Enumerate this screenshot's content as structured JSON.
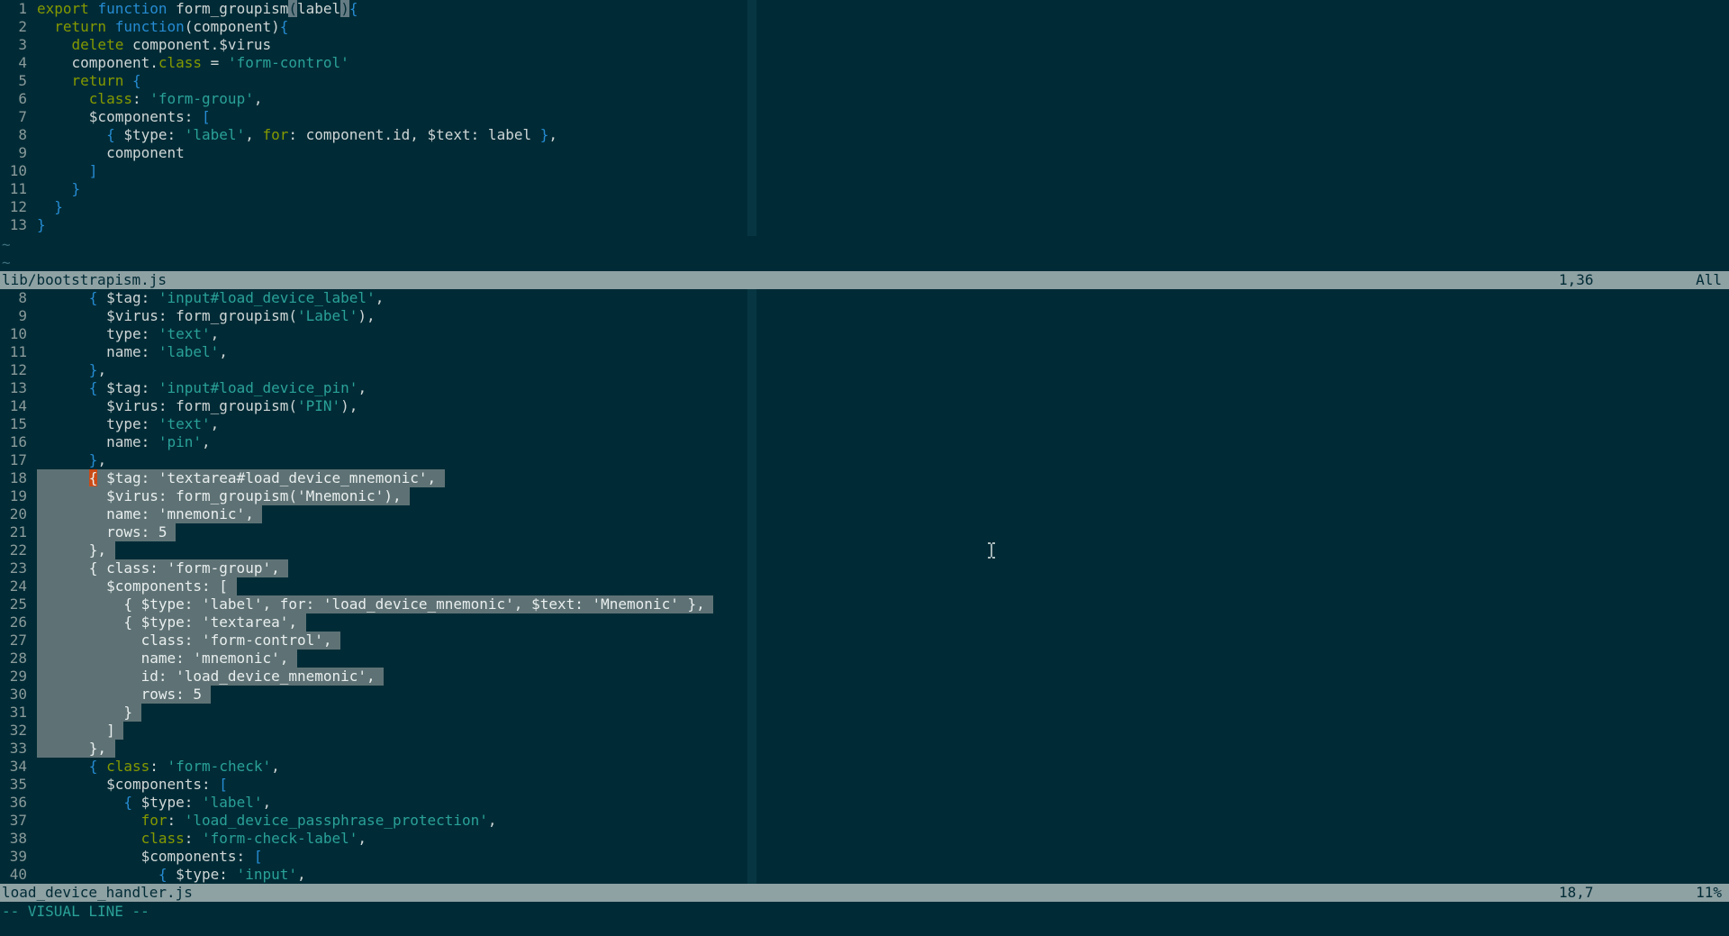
{
  "top_pane": {
    "lines": [
      {
        "n": "1",
        "tokens": [
          {
            "t": "export ",
            "c": "k"
          },
          {
            "t": "function ",
            "c": "f"
          },
          {
            "t": "form_groupism"
          },
          {
            "t": "(",
            "c": "cur"
          },
          {
            "t": "label"
          },
          {
            "t": ")",
            "c": "cur"
          },
          {
            "t": "{",
            "c": "p"
          }
        ]
      },
      {
        "n": "2",
        "tokens": [
          {
            "t": "  "
          },
          {
            "t": "return ",
            "c": "k"
          },
          {
            "t": "function",
            "c": "f"
          },
          {
            "t": "(component)"
          },
          {
            "t": "{",
            "c": "p"
          }
        ]
      },
      {
        "n": "3",
        "tokens": [
          {
            "t": "    "
          },
          {
            "t": "delete ",
            "c": "k"
          },
          {
            "t": "component.$virus"
          }
        ]
      },
      {
        "n": "4",
        "tokens": [
          {
            "t": "    component."
          },
          {
            "t": "class",
            "c": "k"
          },
          {
            "t": " = "
          },
          {
            "t": "'form-control'",
            "c": "s"
          }
        ]
      },
      {
        "n": "5",
        "tokens": [
          {
            "t": "    "
          },
          {
            "t": "return ",
            "c": "k"
          },
          {
            "t": "{",
            "c": "p"
          }
        ]
      },
      {
        "n": "6",
        "tokens": [
          {
            "t": "      "
          },
          {
            "t": "class",
            "c": "k"
          },
          {
            "t": ": "
          },
          {
            "t": "'form-group'",
            "c": "s"
          },
          {
            "t": ","
          }
        ]
      },
      {
        "n": "7",
        "tokens": [
          {
            "t": "      $components: "
          },
          {
            "t": "[",
            "c": "p"
          }
        ]
      },
      {
        "n": "8",
        "tokens": [
          {
            "t": "        "
          },
          {
            "t": "{",
            "c": "p"
          },
          {
            "t": " $type: "
          },
          {
            "t": "'label'",
            "c": "s"
          },
          {
            "t": ", "
          },
          {
            "t": "for",
            "c": "k"
          },
          {
            "t": ": component.id, $text: label "
          },
          {
            "t": "}",
            "c": "p"
          },
          {
            "t": ","
          }
        ]
      },
      {
        "n": "9",
        "tokens": [
          {
            "t": "        component"
          }
        ]
      },
      {
        "n": "10",
        "tokens": [
          {
            "t": "      "
          },
          {
            "t": "]",
            "c": "p"
          }
        ]
      },
      {
        "n": "11",
        "tokens": [
          {
            "t": "    "
          },
          {
            "t": "}",
            "c": "p"
          }
        ]
      },
      {
        "n": "12",
        "tokens": [
          {
            "t": "  "
          },
          {
            "t": "}",
            "c": "p"
          }
        ]
      },
      {
        "n": "13",
        "tokens": [
          {
            "t": "}",
            "c": "p"
          }
        ]
      }
    ],
    "tildes": [
      "~",
      "~"
    ]
  },
  "top_status": {
    "file": "lib/bootstrapism.js",
    "position": "1,36",
    "percent": "All"
  },
  "bottom_pane": {
    "lines": [
      {
        "n": "8",
        "tokens": [
          {
            "t": "      "
          },
          {
            "t": "{",
            "c": "p"
          },
          {
            "t": " $tag: "
          },
          {
            "t": "'input#load_device_label'",
            "c": "s"
          },
          {
            "t": ","
          }
        ]
      },
      {
        "n": "9",
        "tokens": [
          {
            "t": "        $virus: form_groupism("
          },
          {
            "t": "'Label'",
            "c": "s"
          },
          {
            "t": "),"
          }
        ]
      },
      {
        "n": "10",
        "tokens": [
          {
            "t": "        type: "
          },
          {
            "t": "'text'",
            "c": "s"
          },
          {
            "t": ","
          }
        ]
      },
      {
        "n": "11",
        "tokens": [
          {
            "t": "        name: "
          },
          {
            "t": "'label'",
            "c": "s"
          },
          {
            "t": ","
          }
        ]
      },
      {
        "n": "12",
        "tokens": [
          {
            "t": "      "
          },
          {
            "t": "}",
            "c": "p"
          },
          {
            "t": ","
          }
        ]
      },
      {
        "n": "13",
        "tokens": [
          {
            "t": "      "
          },
          {
            "t": "{",
            "c": "p"
          },
          {
            "t": " $tag: "
          },
          {
            "t": "'input#load_device_pin'",
            "c": "s"
          },
          {
            "t": ","
          }
        ]
      },
      {
        "n": "14",
        "tokens": [
          {
            "t": "        $virus: form_groupism("
          },
          {
            "t": "'PIN'",
            "c": "s"
          },
          {
            "t": "),"
          }
        ]
      },
      {
        "n": "15",
        "tokens": [
          {
            "t": "        type: "
          },
          {
            "t": "'text'",
            "c": "s"
          },
          {
            "t": ","
          }
        ]
      },
      {
        "n": "16",
        "tokens": [
          {
            "t": "        name: "
          },
          {
            "t": "'pin'",
            "c": "s"
          },
          {
            "t": ","
          }
        ]
      },
      {
        "n": "17",
        "tokens": [
          {
            "t": "      "
          },
          {
            "t": "}",
            "c": "p"
          },
          {
            "t": ","
          }
        ]
      },
      {
        "n": "18",
        "sel": true,
        "tokens": [
          {
            "t": "      "
          },
          {
            "t": "{",
            "c": "selcursor"
          },
          {
            "t": " $tag: 'textarea#load_device_mnemonic', "
          }
        ]
      },
      {
        "n": "19",
        "sel": true,
        "tokens": [
          {
            "t": "        $virus: form_groupism('Mnemonic'), "
          }
        ]
      },
      {
        "n": "20",
        "sel": true,
        "tokens": [
          {
            "t": "        name: 'mnemonic', "
          }
        ]
      },
      {
        "n": "21",
        "sel": true,
        "tokens": [
          {
            "t": "        rows: 5 "
          }
        ]
      },
      {
        "n": "22",
        "sel": true,
        "tokens": [
          {
            "t": "      }, "
          }
        ]
      },
      {
        "n": "23",
        "sel": true,
        "tokens": [
          {
            "t": "      { class: 'form-group', "
          }
        ]
      },
      {
        "n": "24",
        "sel": true,
        "tokens": [
          {
            "t": "        $components: [ "
          }
        ]
      },
      {
        "n": "25",
        "sel": true,
        "tokens": [
          {
            "t": "          { $type: 'label', for: 'load_device_mnemonic', $text: 'Mnemonic' }, "
          }
        ]
      },
      {
        "n": "26",
        "sel": true,
        "tokens": [
          {
            "t": "          { $type: 'textarea', "
          }
        ]
      },
      {
        "n": "27",
        "sel": true,
        "tokens": [
          {
            "t": "            class: 'form-control', "
          }
        ]
      },
      {
        "n": "28",
        "sel": true,
        "tokens": [
          {
            "t": "            name: 'mnemonic', "
          }
        ]
      },
      {
        "n": "29",
        "sel": true,
        "tokens": [
          {
            "t": "            id: 'load_device_mnemonic', "
          }
        ]
      },
      {
        "n": "30",
        "sel": true,
        "tokens": [
          {
            "t": "            rows: 5 "
          }
        ]
      },
      {
        "n": "31",
        "sel": true,
        "tokens": [
          {
            "t": "          } "
          }
        ]
      },
      {
        "n": "32",
        "sel": true,
        "tokens": [
          {
            "t": "        ] "
          }
        ]
      },
      {
        "n": "33",
        "sel": true,
        "tokens": [
          {
            "t": "      }, "
          }
        ]
      },
      {
        "n": "34",
        "tokens": [
          {
            "t": "      "
          },
          {
            "t": "{",
            "c": "p"
          },
          {
            "t": " "
          },
          {
            "t": "class",
            "c": "k"
          },
          {
            "t": ": "
          },
          {
            "t": "'form-check'",
            "c": "s"
          },
          {
            "t": ","
          }
        ]
      },
      {
        "n": "35",
        "tokens": [
          {
            "t": "        $components: "
          },
          {
            "t": "[",
            "c": "p"
          }
        ]
      },
      {
        "n": "36",
        "tokens": [
          {
            "t": "          "
          },
          {
            "t": "{",
            "c": "p"
          },
          {
            "t": " $type: "
          },
          {
            "t": "'label'",
            "c": "s"
          },
          {
            "t": ","
          }
        ]
      },
      {
        "n": "37",
        "tokens": [
          {
            "t": "            "
          },
          {
            "t": "for",
            "c": "k"
          },
          {
            "t": ": "
          },
          {
            "t": "'load_device_passphrase_protection'",
            "c": "s"
          },
          {
            "t": ","
          }
        ]
      },
      {
        "n": "38",
        "tokens": [
          {
            "t": "            "
          },
          {
            "t": "class",
            "c": "k"
          },
          {
            "t": ": "
          },
          {
            "t": "'form-check-label'",
            "c": "s"
          },
          {
            "t": ","
          }
        ]
      },
      {
        "n": "39",
        "tokens": [
          {
            "t": "            $components: "
          },
          {
            "t": "[",
            "c": "p"
          }
        ]
      },
      {
        "n": "40",
        "tokens": [
          {
            "t": "              "
          },
          {
            "t": "{",
            "c": "p"
          },
          {
            "t": " $type: "
          },
          {
            "t": "'input'",
            "c": "s"
          },
          {
            "t": ","
          }
        ]
      }
    ]
  },
  "bottom_status": {
    "file": "load_device_handler.js",
    "position": "18,7",
    "percent": "11%"
  },
  "mode_line": "-- VISUAL LINE --",
  "colors": {
    "background": "#002b36",
    "status_bar": "#8ea1a3",
    "selection": "#5e7275",
    "keyword": "#859900",
    "function": "#268bd2",
    "string": "#2aa198",
    "cursor_visual": "#cb4b16"
  },
  "icons": {
    "mouse_pointer": "ibeam-cursor-icon"
  }
}
